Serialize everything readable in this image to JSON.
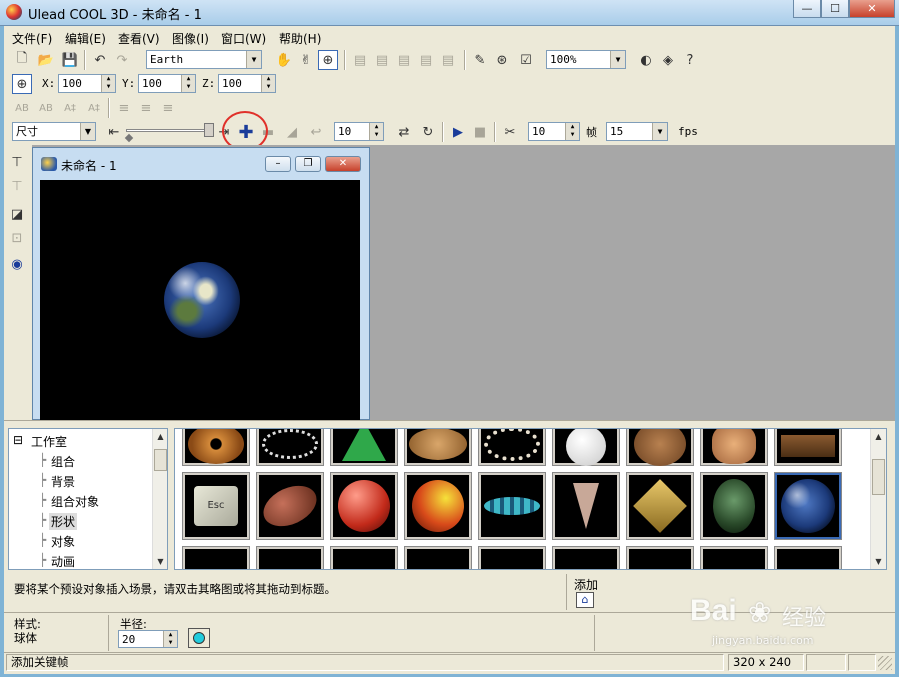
{
  "window": {
    "title": "Ulead COOL 3D - 未命名 - 1",
    "min": "—",
    "max": "☐",
    "close": "✕"
  },
  "menu": [
    "文件(F)",
    "编辑(E)",
    "查看(V)",
    "图像(I)",
    "窗口(W)",
    "帮助(H)"
  ],
  "toolbar1": {
    "object_combo": "Earth",
    "zoom": "100%"
  },
  "toolbar2": {
    "x_label": "X:",
    "x_value": "100",
    "y_label": "Y:",
    "y_value": "100",
    "z_label": "Z:",
    "z_value": "100"
  },
  "toolbar3": {
    "text_buttons": [
      "AB",
      "AB",
      "A‡",
      "A‡"
    ]
  },
  "animation": {
    "attribute": "尺寸",
    "frame": "10",
    "total_frames": "10",
    "frame_label": "帧",
    "fps": "15",
    "fps_label": "fps"
  },
  "document": {
    "title": "未命名 - 1"
  },
  "tree": {
    "root": "工作室",
    "items": [
      "组合",
      "背景",
      "组合对象",
      "形状",
      "对象",
      "动画"
    ],
    "selected": "形状"
  },
  "thumbnails": {
    "row1": [
      "donut",
      "necklace",
      "cone-green",
      "wood-disk",
      "beads",
      "snowman",
      "bear",
      "figure",
      "box-brown"
    ],
    "row2": [
      "esc-key",
      "football",
      "basketball",
      "sphere-yellow-red",
      "spinning-top",
      "pine-cone",
      "diamond-face",
      "egg-mountain",
      "earth"
    ],
    "selected": "earth"
  },
  "hint": "要将某个预设对象插入场景，请双击其略图或将其拖动到标题。",
  "add_label": "添加",
  "props": {
    "style_label": "样式:",
    "style_value": "球体",
    "radius_label": "半径:",
    "radius_value": "20"
  },
  "status": {
    "text": "添加关键帧",
    "size": "320 x 240"
  },
  "watermark": {
    "brand": "Bai",
    "brand2": "经验",
    "url": "jingyan.baidu.com"
  },
  "colors": {
    "accent": "#3a6ab5",
    "highlight_circle": "#e0302a",
    "swatch": "#22ccdd"
  }
}
